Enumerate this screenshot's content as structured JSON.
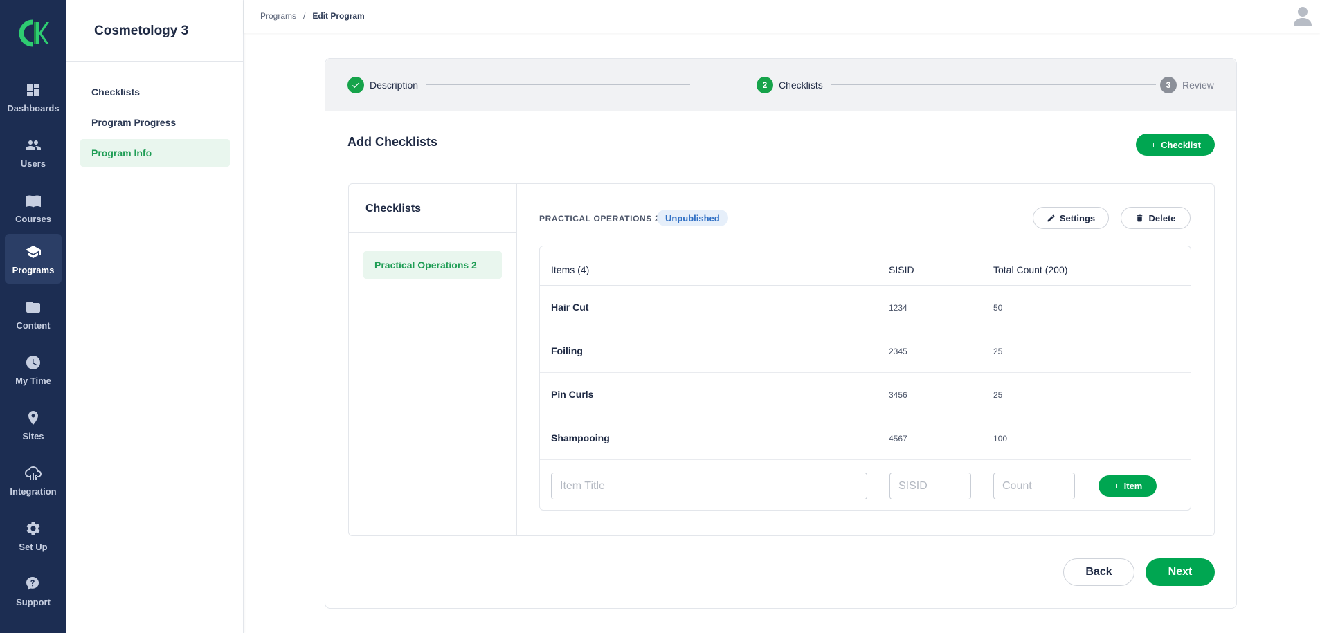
{
  "rail": {
    "items": [
      {
        "label": "Dashboards",
        "icon": "dashboard-icon"
      },
      {
        "label": "Users",
        "icon": "users-icon"
      },
      {
        "label": "Courses",
        "icon": "book-icon"
      },
      {
        "label": "Programs",
        "icon": "graduation-cap-icon"
      },
      {
        "label": "Content",
        "icon": "folder-icon"
      },
      {
        "label": "My Time",
        "icon": "clock-icon"
      },
      {
        "label": "Sites",
        "icon": "location-pin-icon"
      },
      {
        "label": "Integration",
        "icon": "cloud-network-icon"
      },
      {
        "label": "Set Up",
        "icon": "gear-icon"
      },
      {
        "label": "Support",
        "icon": "support-chat-icon"
      }
    ],
    "active": "Programs"
  },
  "sidebar": {
    "title": "Cosmetology 3",
    "links": [
      {
        "label": "Checklists"
      },
      {
        "label": "Program Progress"
      },
      {
        "label": "Program Info"
      }
    ],
    "active": "Program Info"
  },
  "breadcrumb": {
    "parent": "Programs",
    "separator": "/",
    "current": "Edit Program"
  },
  "stepper": {
    "steps": [
      {
        "number": "1",
        "label": "Description",
        "state": "done"
      },
      {
        "number": "2",
        "label": "Checklists",
        "state": "current"
      },
      {
        "number": "3",
        "label": "Review",
        "state": "todo"
      }
    ]
  },
  "main": {
    "heading": "Add Checklists",
    "add_checklist_label": "Checklist",
    "checklists_title": "Checklists",
    "checklists": [
      "Practical Operations 2"
    ],
    "selected": {
      "name": "PRACTICAL OPERATIONS 2",
      "status": "Unpublished",
      "settings_label": "Settings",
      "delete_label": "Delete"
    },
    "table": {
      "headers": [
        "Items (4)",
        "SISID",
        "Total Count (200)"
      ],
      "rows": [
        {
          "title": "Hair Cut",
          "sisid": "1234",
          "count": "50"
        },
        {
          "title": "Foiling",
          "sisid": "2345",
          "count": "25"
        },
        {
          "title": "Pin Curls",
          "sisid": "3456",
          "count": "25"
        },
        {
          "title": "Shampooing",
          "sisid": "4567",
          "count": "100"
        }
      ],
      "new_item": {
        "title_placeholder": "Item Title",
        "sisid_placeholder": "SISID",
        "count_placeholder": "Count",
        "add_label": "Item"
      }
    },
    "back_label": "Back",
    "next_label": "Next"
  },
  "colors": {
    "rail_bg": "#1c2d52",
    "accent_green": "#00a651",
    "badge_blue": "#2f6fc4"
  }
}
